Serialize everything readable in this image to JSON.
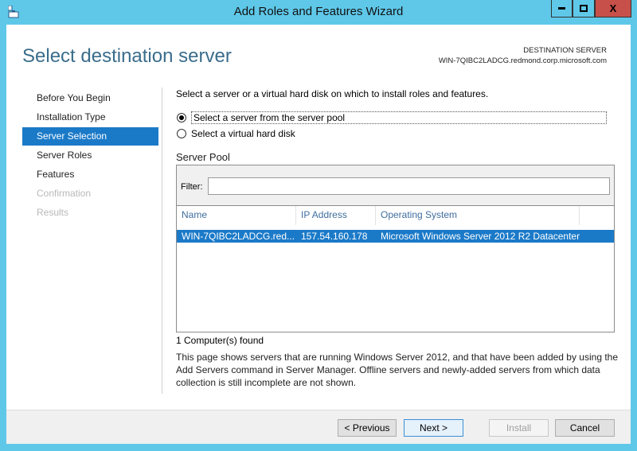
{
  "window": {
    "title": "Add Roles and Features Wizard",
    "minimize": "▬",
    "maximize": "□",
    "close": "X"
  },
  "header": {
    "title": "Select destination server",
    "dest_label": "DESTINATION SERVER",
    "dest_name": "WIN-7QIBC2LADCG.redmond.corp.microsoft.com"
  },
  "nav": [
    {
      "label": "Before You Begin"
    },
    {
      "label": "Installation Type"
    },
    {
      "label": "Server Selection"
    },
    {
      "label": "Server Roles"
    },
    {
      "label": "Features"
    },
    {
      "label": "Confirmation"
    },
    {
      "label": "Results"
    }
  ],
  "main": {
    "intro": "Select a server or a virtual hard disk on which to install roles and features.",
    "options": [
      {
        "label": "Select a server from the server pool",
        "selected": true
      },
      {
        "label": "Select a virtual hard disk",
        "selected": false
      }
    ],
    "pool_title": "Server Pool",
    "filter_label": "Filter:",
    "filter_value": "",
    "columns": [
      "Name",
      "IP Address",
      "Operating System"
    ],
    "rows": [
      {
        "name": "WIN-7QIBC2LADCG.red...",
        "ip": "157.54.160.178",
        "os": "Microsoft Windows Server 2012 R2 Datacenter"
      }
    ],
    "found": "1 Computer(s) found",
    "description": "This page shows servers that are running Windows Server 2012, and that have been added by using the Add Servers command in Server Manager. Offline servers and newly-added servers from which data collection is still incomplete are not shown."
  },
  "buttons": {
    "previous": "< Previous",
    "next": "Next >",
    "install": "Install",
    "cancel": "Cancel"
  }
}
